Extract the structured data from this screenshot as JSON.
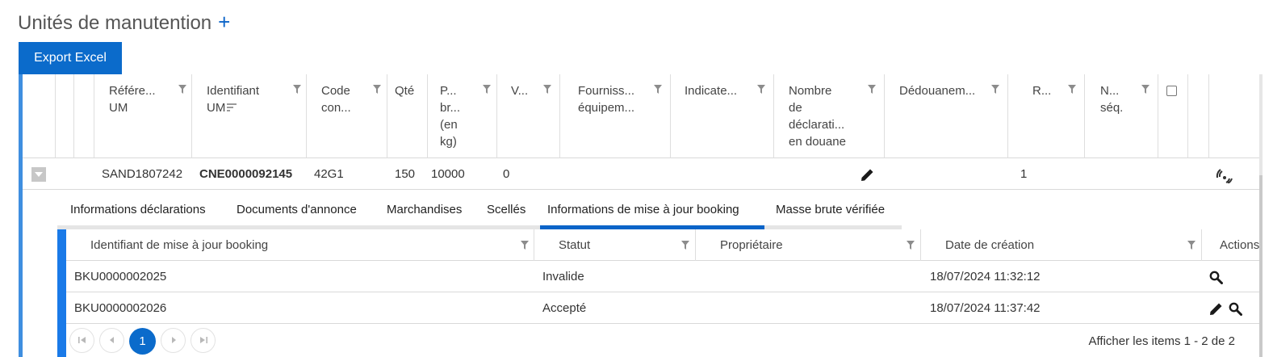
{
  "page": {
    "title": "Unités de manutention",
    "add_symbol": "+",
    "export_label": "Export Excel"
  },
  "grid": {
    "columns": [
      {
        "l1": "Référe...",
        "l2": "UM"
      },
      {
        "l1": "Identifiant",
        "l2": "UM"
      },
      {
        "l1": "Code",
        "l2": "con..."
      },
      {
        "l1": "Qté"
      },
      {
        "l1": "P...",
        "l2": "br...",
        "l3": "(en",
        "l4": "kg)"
      },
      {
        "l1": "V..."
      },
      {
        "l1": "Fourniss...",
        "l2": "équipem..."
      },
      {
        "l1": "Indicate..."
      },
      {
        "l1": "Nombre",
        "l2": "de",
        "l3": "déclarati...",
        "l4": "en douane"
      },
      {
        "l1": "Dédouanem..."
      },
      {
        "l1": "R..."
      },
      {
        "l1": "N...",
        "l2": "séq."
      }
    ],
    "row": {
      "reference": "SAND1807242",
      "identifiant": "CNE0000092145",
      "code": "42G1",
      "qte": "150",
      "poids": "10000",
      "v": "0",
      "r": "1"
    }
  },
  "tabs": [
    "Informations déclarations",
    "Documents d'annonce",
    "Marchandises",
    "Scellés",
    "Informations de mise à jour booking",
    "Masse brute vérifiée"
  ],
  "active_tab": "Informations de mise à jour booking",
  "sub_grid": {
    "headers": {
      "identifiant": "Identifiant de mise à jour booking",
      "statut": "Statut",
      "proprietaire": "Propriétaire",
      "date": "Date de création",
      "actions": "Actions"
    },
    "rows": [
      {
        "identifiant": "BKU0000002025",
        "statut": "Invalide",
        "proprietaire": "",
        "date": "18/07/2024 11:32:12"
      },
      {
        "identifiant": "BKU0000002026",
        "statut": "Accepté",
        "proprietaire": "",
        "date": "18/07/2024 11:37:42"
      }
    ],
    "pager": {
      "current_page": "1",
      "info": "Afficher les items 1 - 2 de 2"
    }
  },
  "icons": {
    "filter": "filter-icon",
    "sort": "sort-icon",
    "edit": "pencil-icon",
    "view": "magnifier-icon",
    "tracking": "signal-icon",
    "expand": "triangle-down-icon"
  },
  "colors": {
    "primary": "#0b6bcb",
    "accent_bar": "#1a7ae8",
    "grid_border": "#d9d9d9"
  }
}
